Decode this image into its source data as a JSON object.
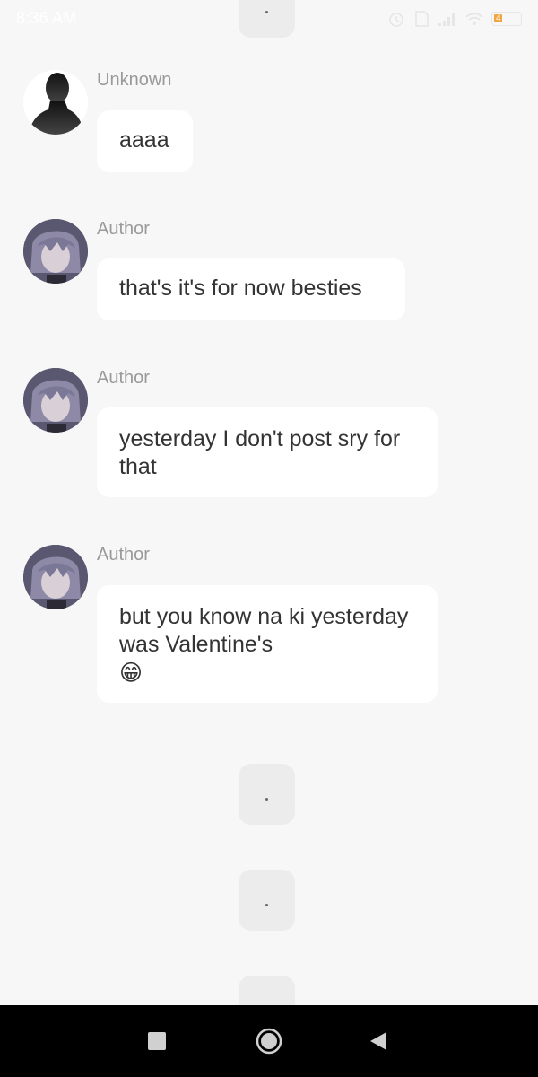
{
  "status_bar": {
    "time": "8:36 AM",
    "battery_level": "4"
  },
  "messages": [
    {
      "sender": "Unknown",
      "text": "aaaa",
      "avatar": "silhouette-avatar"
    },
    {
      "sender": "Author",
      "text": "that's it's for now besties",
      "avatar": "anime-character-avatar"
    },
    {
      "sender": "Author",
      "text": "yesterday I don't post sry for that",
      "avatar": "anime-character-avatar"
    },
    {
      "sender": "Author",
      "text": "but you know na ki yesterday was Valentine's",
      "emoji": "😁",
      "avatar": "anime-character-avatar"
    }
  ],
  "dividers": [
    "·",
    "·",
    "·",
    "·"
  ],
  "nav_bar": {
    "recent_apps_icon": "square-icon",
    "home_icon": "circle-icon",
    "back_icon": "triangle-back-icon"
  }
}
